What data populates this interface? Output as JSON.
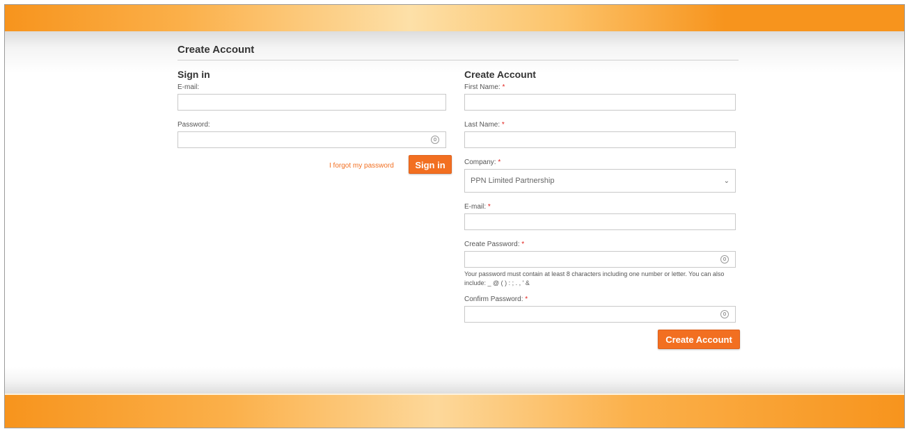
{
  "page": {
    "title": "Create Account"
  },
  "signin": {
    "heading": "Sign in",
    "email_label": "E-mail:",
    "email_value": "",
    "password_label": "Password:",
    "password_value": "",
    "forgot_link": "I forgot my password",
    "button_label": "Sign in"
  },
  "create_account": {
    "heading": "Create Account",
    "first_name_label": "First Name:",
    "last_name_label": "Last Name:",
    "company_label": "Company:",
    "company_selected": "PPN Limited Partnership",
    "email_label": "E-mail:",
    "password_label": "Create Password:",
    "password_hint": "Your password must contain at least 8 characters including one number or letter. You can also include: _ @ ( ) : ; . , ' &",
    "confirm_password_label": "Confirm Password:",
    "required_marker": "*",
    "button_label": "Create Account"
  },
  "icons": {
    "password_visibility": "eye-icon",
    "dropdown": "chevron-down-icon"
  },
  "colors": {
    "accent": "#f26f21",
    "banner": "#f7941d",
    "required": "#e2211c"
  }
}
